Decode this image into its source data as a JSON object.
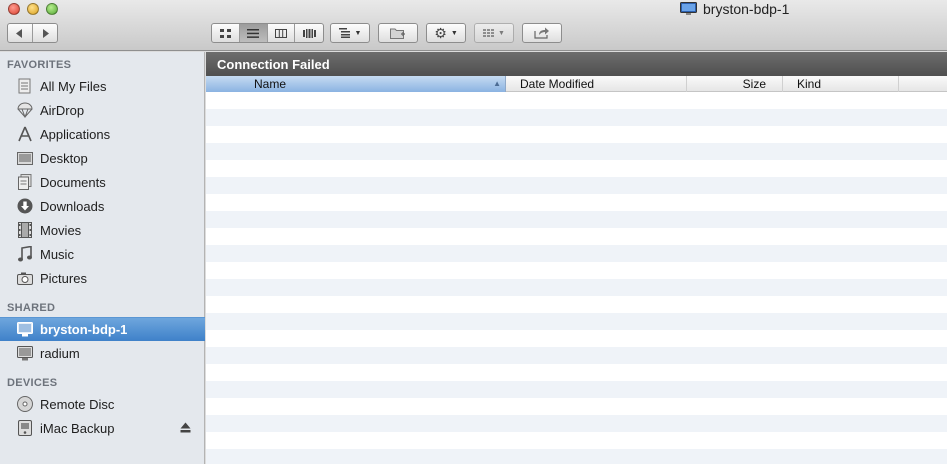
{
  "window": {
    "title": "bryston-bdp-1"
  },
  "path_bar": {
    "status": "Connection Failed"
  },
  "columns": {
    "name": "Name",
    "date": "Date Modified",
    "size": "Size",
    "kind": "Kind"
  },
  "sidebar": {
    "favorites_header": "FAVORITES",
    "favorites": [
      {
        "label": "All My Files",
        "icon": "all-files-icon"
      },
      {
        "label": "AirDrop",
        "icon": "airdrop-icon"
      },
      {
        "label": "Applications",
        "icon": "applications-icon"
      },
      {
        "label": "Desktop",
        "icon": "desktop-icon"
      },
      {
        "label": "Documents",
        "icon": "documents-icon"
      },
      {
        "label": "Downloads",
        "icon": "downloads-icon"
      },
      {
        "label": "Movies",
        "icon": "movies-icon"
      },
      {
        "label": "Music",
        "icon": "music-icon"
      },
      {
        "label": "Pictures",
        "icon": "pictures-icon"
      }
    ],
    "shared_header": "SHARED",
    "shared": [
      {
        "label": "bryston-bdp-1",
        "icon": "monitor-icon",
        "selected": true
      },
      {
        "label": "radium",
        "icon": "monitor-icon"
      }
    ],
    "devices_header": "DEVICES",
    "devices": [
      {
        "label": "Remote Disc",
        "icon": "disc-icon"
      },
      {
        "label": "iMac Backup",
        "icon": "hard-drive-icon"
      }
    ]
  },
  "colors": {
    "selection": "#3f81c9",
    "path_bar": "#5c5c5c",
    "row_stripe": "#eff3f8"
  }
}
